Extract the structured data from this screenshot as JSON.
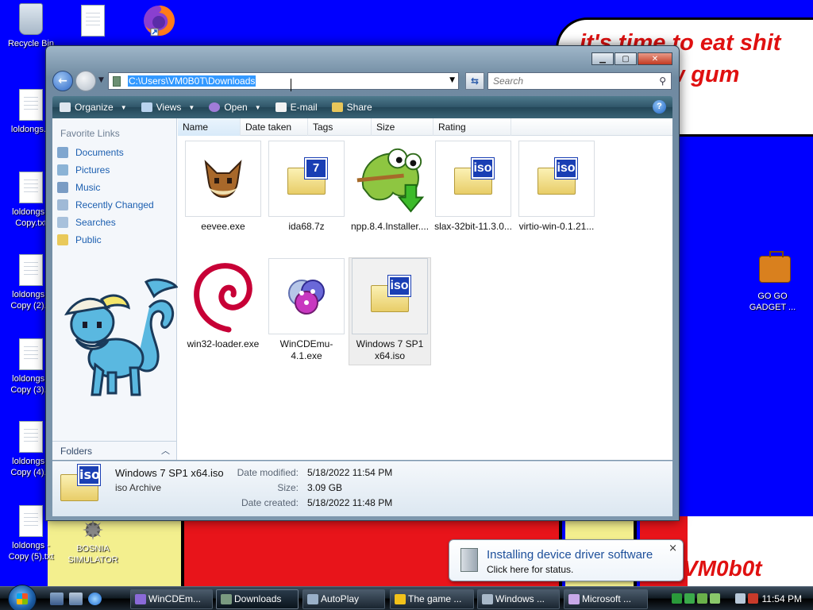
{
  "wallpaper": {
    "bubble_text": "it's time to eat shit and chew gum",
    "signature": "VM0b0t"
  },
  "desktop_icons": {
    "left": [
      {
        "label": "Recycle Bin",
        "kind": "recycle-bin"
      },
      {
        "label": "loldongs...",
        "kind": "document"
      },
      {
        "label": "loldongs - Copy.txt",
        "kind": "document"
      },
      {
        "label": "loldongs - Copy (2)...",
        "kind": "document"
      },
      {
        "label": "loldongs - Copy (3)...",
        "kind": "document"
      },
      {
        "label": "loldongs - Copy (4)...",
        "kind": "document"
      },
      {
        "label": "loldongs - Copy (5).txt",
        "kind": "document"
      }
    ],
    "top": [
      {
        "label": "",
        "kind": "document"
      },
      {
        "label": "",
        "kind": "firefox"
      }
    ],
    "bosnia": "BOSNIA SIMULATOR",
    "gadget": "GO GO GADGET ..."
  },
  "explorer": {
    "address": "C:\\Users\\VM0B0T\\Downloads",
    "search_placeholder": "Search",
    "toolbar": {
      "organize": "Organize",
      "views": "Views",
      "open": "Open",
      "email": "E-mail",
      "share": "Share",
      "help": "?"
    },
    "favorite_links_title": "Favorite Links",
    "favorites": [
      "Documents",
      "Pictures",
      "Music",
      "Recently Changed",
      "Searches",
      "Public"
    ],
    "folders_label": "Folders",
    "columns": [
      "Name",
      "Date taken",
      "Tags",
      "Size",
      "Rating"
    ],
    "files": [
      {
        "name": "eevee.exe",
        "kind": "exe-eevee"
      },
      {
        "name": "ida68.7z",
        "kind": "7z"
      },
      {
        "name": "npp.8.4.Installer....",
        "kind": "npp"
      },
      {
        "name": "slax-32bit-11.3.0...",
        "kind": "iso"
      },
      {
        "name": "virtio-win-0.1.21...",
        "kind": "iso"
      },
      {
        "name": "win32-loader.exe",
        "kind": "debian"
      },
      {
        "name": "WinCDEmu-4.1.exe",
        "kind": "wincdemu"
      },
      {
        "name": "Windows 7 SP1 x64.iso",
        "kind": "iso",
        "selected": true
      }
    ],
    "details": {
      "name": "Windows 7 SP1 x64.iso",
      "type": "iso Archive",
      "date_modified_label": "Date modified:",
      "date_modified": "5/18/2022 11:54 PM",
      "size_label": "Size:",
      "size": "3.09 GB",
      "date_created_label": "Date created:",
      "date_created": "5/18/2022 11:48 PM"
    }
  },
  "notification": {
    "title": "Installing device driver software",
    "subtitle": "Click here for status.",
    "close": "×"
  },
  "taskbar": {
    "buttons": [
      "WinCDEm...",
      "Downloads",
      "AutoPlay",
      "The game ...",
      "Windows ...",
      "Microsoft ..."
    ],
    "clock": "11:54 PM"
  }
}
